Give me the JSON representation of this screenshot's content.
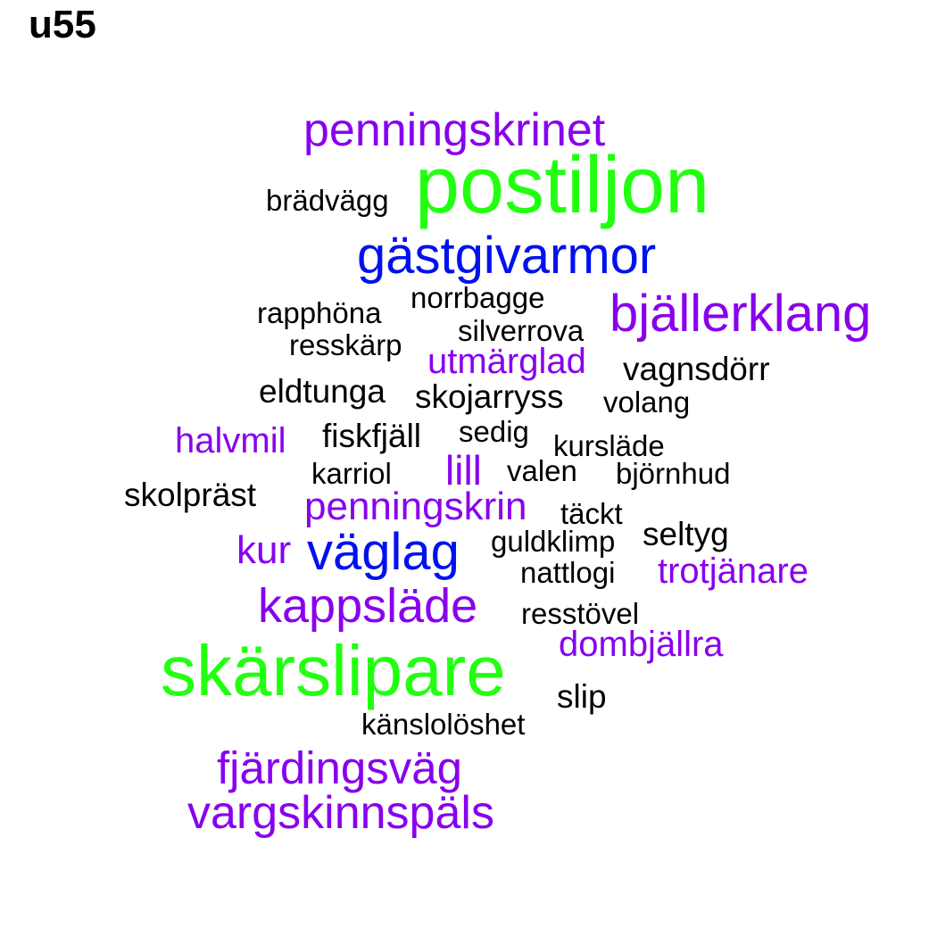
{
  "title": "u55",
  "colors": {
    "green": "#22ff11",
    "blue": "#0011ee",
    "purple": "#8800ee",
    "black": "#000000"
  },
  "words": [
    {
      "text": "penningskrinet",
      "color": "purple"
    },
    {
      "text": "postiljon",
      "color": "green"
    },
    {
      "text": "brädvägg",
      "color": "black"
    },
    {
      "text": "gästgivarmor",
      "color": "blue"
    },
    {
      "text": "norrbagge",
      "color": "black"
    },
    {
      "text": "rapphöna",
      "color": "black"
    },
    {
      "text": "bjällerklang",
      "color": "purple"
    },
    {
      "text": "silverrova",
      "color": "black"
    },
    {
      "text": "resskärp",
      "color": "black"
    },
    {
      "text": "utmärglad",
      "color": "purple"
    },
    {
      "text": "vagnsdörr",
      "color": "black"
    },
    {
      "text": "eldtunga",
      "color": "black"
    },
    {
      "text": "skojarryss",
      "color": "black"
    },
    {
      "text": "volang",
      "color": "black"
    },
    {
      "text": "halvmil",
      "color": "purple"
    },
    {
      "text": "fiskfjäll",
      "color": "black"
    },
    {
      "text": "sedig",
      "color": "black"
    },
    {
      "text": "kursläde",
      "color": "black"
    },
    {
      "text": "karriol",
      "color": "black"
    },
    {
      "text": "lill",
      "color": "purple"
    },
    {
      "text": "valen",
      "color": "black"
    },
    {
      "text": "björnhud",
      "color": "black"
    },
    {
      "text": "skolpräst",
      "color": "black"
    },
    {
      "text": "penningskrin",
      "color": "purple"
    },
    {
      "text": "täckt",
      "color": "black"
    },
    {
      "text": "seltyg",
      "color": "black"
    },
    {
      "text": "kur",
      "color": "purple"
    },
    {
      "text": "väglag",
      "color": "blue"
    },
    {
      "text": "guldklimp",
      "color": "black"
    },
    {
      "text": "nattlogi",
      "color": "black"
    },
    {
      "text": "trotjänare",
      "color": "purple"
    },
    {
      "text": "kappsläde",
      "color": "purple"
    },
    {
      "text": "resstövel",
      "color": "black"
    },
    {
      "text": "dombjällra",
      "color": "purple"
    },
    {
      "text": "skärslipare",
      "color": "green"
    },
    {
      "text": "slip",
      "color": "black"
    },
    {
      "text": "känslolöshet",
      "color": "black"
    },
    {
      "text": "fjärdingsväg",
      "color": "purple"
    },
    {
      "text": "vargskinnspäls",
      "color": "purple"
    }
  ]
}
